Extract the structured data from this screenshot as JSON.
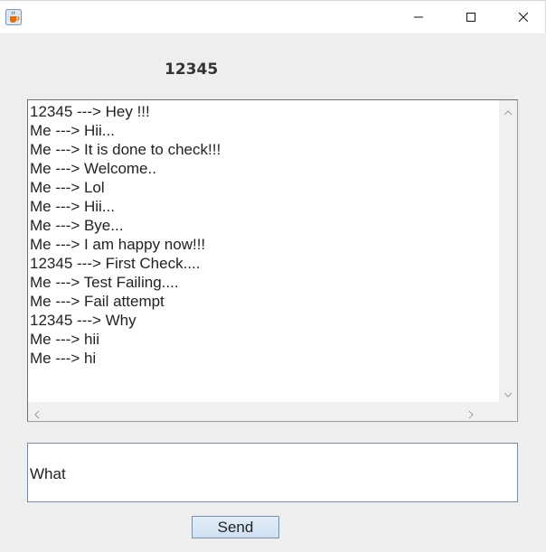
{
  "window": {
    "app_icon": "java-cup-icon",
    "controls": [
      "minimize-icon",
      "maximize-icon",
      "close-icon"
    ]
  },
  "chat": {
    "title": "12345",
    "messages": [
      "12345 ---> Hey !!!",
      "Me ---> Hii...",
      "Me ---> It is done to check!!!",
      "Me ---> Welcome..",
      "Me ---> Lol",
      "Me ---> Hii...",
      "Me ---> Bye...",
      "Me ---> I am happy now!!!",
      "12345 ---> First Check....",
      "Me ---> Test Failing....",
      "Me ---> Fail attempt",
      "12345 ---> Why",
      "Me ---> hii",
      "Me ---> hi"
    ]
  },
  "input": {
    "value": "What"
  },
  "send_button": {
    "label": "Send"
  }
}
